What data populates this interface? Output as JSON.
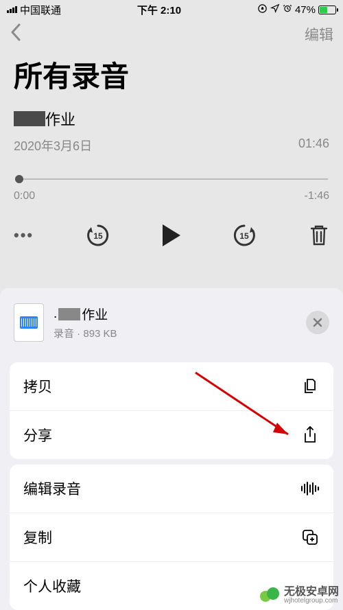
{
  "status": {
    "carrier": "中国联通",
    "time": "下午 2:10",
    "battery_pct": "47%"
  },
  "nav": {
    "edit_label": "编辑"
  },
  "page_title": "所有录音",
  "recording": {
    "title_suffix": "作业",
    "date": "2020年3月6日",
    "duration": "01:46",
    "elapsed": "0:00",
    "remaining": "-1:46"
  },
  "sheet": {
    "file_title_suffix": "作业",
    "file_type": "录音",
    "file_size": "893 KB"
  },
  "actions": {
    "copy": "拷贝",
    "share": "分享",
    "edit_recording": "编辑录音",
    "duplicate": "复制",
    "add_favorites": "个人收藏"
  },
  "watermark": {
    "cn": "无极安卓网",
    "en": "wjhotelgroup.com"
  }
}
